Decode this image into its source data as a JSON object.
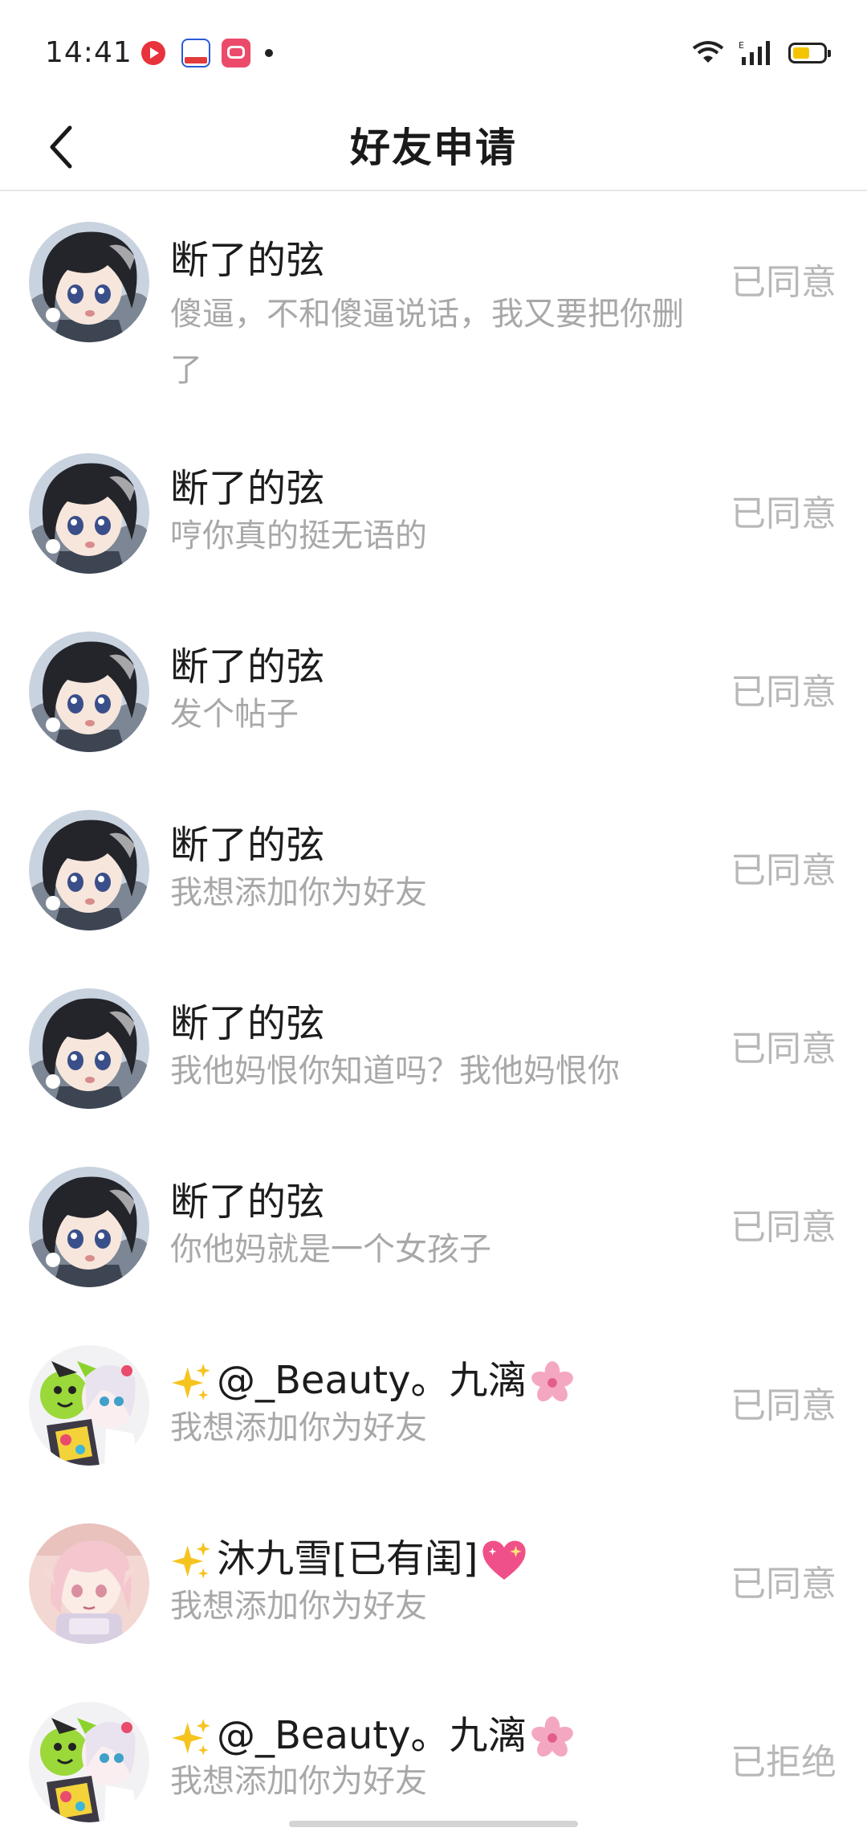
{
  "status_bar": {
    "time": "14:41"
  },
  "header": {
    "title": "好友申请"
  },
  "requests": [
    {
      "name": "断了的弦",
      "message": "傻逼，不和傻逼说话，我又要把你删了",
      "status": "已同意",
      "avatar": "anime-dark-hair-avatar"
    },
    {
      "name": "断了的弦",
      "message": "哼你真的挺无语的",
      "status": "已同意",
      "avatar": "anime-dark-hair-avatar"
    },
    {
      "name": "断了的弦",
      "message": "发个帖子",
      "status": "已同意",
      "avatar": "anime-dark-hair-avatar"
    },
    {
      "name": "断了的弦",
      "message": "我想添加你为好友",
      "status": "已同意",
      "avatar": "anime-dark-hair-avatar"
    },
    {
      "name": "断了的弦",
      "message": "我他妈恨你知道吗？我他妈恨你",
      "status": "已同意",
      "avatar": "anime-dark-hair-avatar"
    },
    {
      "name": "断了的弦",
      "message": "你他妈就是一个女孩子",
      "status": "已同意",
      "avatar": "anime-dark-hair-avatar"
    },
    {
      "name": "@_Beauty。九漓",
      "message": "我想添加你为好友",
      "status": "已同意",
      "avatar": "anime-colorful-avatar",
      "prefix_icon": "sparkles-icon",
      "suffix_icon": "cherry-blossom-icon"
    },
    {
      "name": "沐九雪[已有闺]",
      "message": "我想添加你为好友",
      "status": "已同意",
      "avatar": "anime-pink-hair-avatar",
      "prefix_icon": "sparkles-icon",
      "suffix_icon": "sparkling-heart-icon"
    },
    {
      "name": "@_Beauty。九漓",
      "message": "我想添加你为好友",
      "status": "已拒绝",
      "avatar": "anime-colorful-avatar",
      "prefix_icon": "sparkles-icon",
      "suffix_icon": "cherry-blossom-icon"
    }
  ],
  "colors": {
    "name_text": "#1c1c1c",
    "message_text": "#a8a8a8",
    "status_text": "#b8b8b8",
    "divider": "#e6e6e6",
    "battery_fill": "#f5c400"
  }
}
